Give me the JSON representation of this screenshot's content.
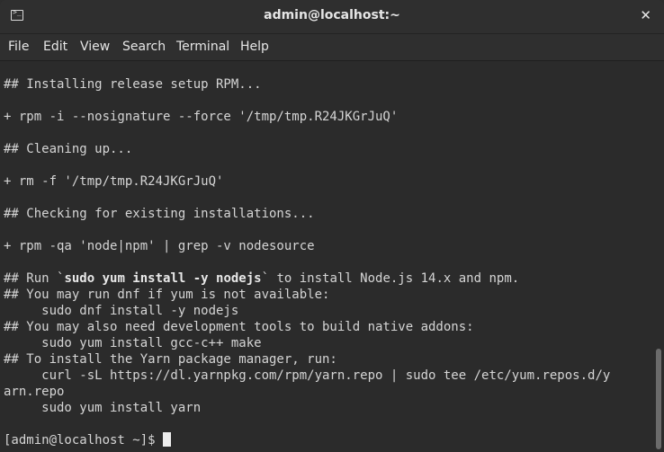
{
  "window": {
    "title": "admin@localhost:~"
  },
  "menu": {
    "file": "File",
    "edit": "Edit",
    "view": "View",
    "search": "Search",
    "terminal": "Terminal",
    "help": "Help"
  },
  "terminal": {
    "lines": {
      "l1": "## Installing release setup RPM...",
      "l2": "+ rpm -i --nosignature --force '/tmp/tmp.R24JKGrJuQ'",
      "l3": "## Cleaning up...",
      "l4": "+ rm -f '/tmp/tmp.R24JKGrJuQ'",
      "l5": "## Checking for existing installations...",
      "l6": "+ rpm -qa 'node|npm' | grep -v nodesource",
      "l7a": "## Run `",
      "l7b": "sudo yum install -y nodejs",
      "l7c": "` to install Node.js 14.x and npm.",
      "l8": "## You may run dnf if yum is not available:",
      "l9": "     sudo dnf install -y nodejs",
      "l10": "## You may also need development tools to build native addons:",
      "l11": "     sudo yum install gcc-c++ make",
      "l12": "## To install the Yarn package manager, run:",
      "l13": "     curl -sL https://dl.yarnpkg.com/rpm/yarn.repo | sudo tee /etc/yum.repos.d/y",
      "l14": "arn.repo",
      "l15": "     sudo yum install yarn",
      "prompt": "[admin@localhost ~]$ "
    }
  },
  "icons": {
    "app": "terminal-icon",
    "close": "close-icon"
  }
}
